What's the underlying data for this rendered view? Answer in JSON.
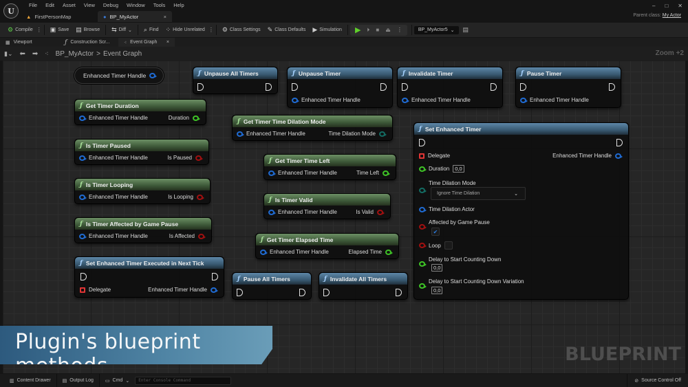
{
  "app": {
    "logo": "U",
    "menu": [
      "File",
      "Edit",
      "Asset",
      "View",
      "Debug",
      "Window",
      "Tools",
      "Help"
    ],
    "doc_tabs": [
      {
        "label": "FirstPersonMap",
        "icon": "level-icon"
      },
      {
        "label": "BP_MyActor",
        "icon": "blueprint-icon",
        "close": "×"
      }
    ],
    "window_controls": {
      "minimize": "–",
      "maximize": "□",
      "close": "✕"
    },
    "parent_class_label": "Parent class:",
    "parent_class_value": "My Actor"
  },
  "toolbar": {
    "compile": "Compile",
    "save": "Save",
    "browse": "Browse",
    "diff": "Diff",
    "find": "Find",
    "hide_unrelated": "Hide Unrelated",
    "class_settings": "Class Settings",
    "class_defaults": "Class Defaults",
    "simulation": "Simulation",
    "debug_object": "BP_MyActor5",
    "more": "⋮"
  },
  "panel_tabs": [
    {
      "label": "Viewport"
    },
    {
      "label": "Construction Scr..."
    },
    {
      "label": "Event Graph",
      "close": "×"
    }
  ],
  "breadcrumb": {
    "root": "BP_MyActor",
    "sep": ">",
    "current": "Event Graph"
  },
  "zoom_label": "Zoom +2",
  "graph": {
    "variable_node": {
      "label": "Enhanced Timer Handle"
    },
    "nodes": {
      "get_timer_duration": {
        "title": "Get Timer Duration",
        "in": "Enhanced Timer Handle",
        "out": "Duration"
      },
      "is_timer_paused": {
        "title": "Is Timer Paused",
        "in": "Enhanced Timer Handle",
        "out": "Is Paused"
      },
      "is_timer_looping": {
        "title": "Is Timer Looping",
        "in": "Enhanced Timer Handle",
        "out": "Is Looping"
      },
      "is_timer_affected": {
        "title": "Is Timer Affected by Game Pause",
        "in": "Enhanced Timer Handle",
        "out": "Is Affected"
      },
      "set_next_tick": {
        "title": "Set Enhanced Timer Executed in Next Tick",
        "in": "Delegate",
        "out": "Enhanced Timer Handle"
      },
      "unpause_all": {
        "title": "Unpause All Timers"
      },
      "unpause_timer": {
        "title": "Unpause Timer",
        "in": "Enhanced Timer Handle"
      },
      "invalidate_timer": {
        "title": "Invalidate Timer",
        "in": "Enhanced Timer Handle"
      },
      "pause_timer": {
        "title": "Pause Timer",
        "in": "Enhanced Timer Handle"
      },
      "get_dilation_mode": {
        "title": "Get Timer Time Dilation Mode",
        "in": "Enhanced Timer Handle",
        "out": "Time Dilation Mode"
      },
      "get_time_left": {
        "title": "Get Timer Time Left",
        "in": "Enhanced Timer Handle",
        "out": "Time Left"
      },
      "is_timer_valid": {
        "title": "Is Timer Valid",
        "in": "Enhanced Timer Handle",
        "out": "Is Valid"
      },
      "get_elapsed": {
        "title": "Get Timer Elapsed Time",
        "in": "Enhanced Timer Handle",
        "out": "Elapsed Time"
      },
      "pause_all": {
        "title": "Pause All Timers"
      },
      "invalidate_all": {
        "title": "Invalidate All Timers"
      },
      "set_enhanced_timer": {
        "title": "Set Enhanced Timer",
        "delegate": "Delegate",
        "out": "Enhanced Timer Handle",
        "duration_label": "Duration",
        "duration_value": "0,0",
        "dilation_mode_label": "Time Dilation Mode",
        "dilation_mode_value": "Ignore Time Dilation",
        "dilation_actor_label": "Time Dilation Actor",
        "affected_label": "Affected by Game Pause",
        "affected_checked": true,
        "loop_label": "Loop",
        "loop_checked": false,
        "delay_label": "Delay to Start Counting Down",
        "delay_value": "0,0",
        "delay_var_label": "Delay to Start Counting Down Variation",
        "delay_var_value": "0,0"
      }
    }
  },
  "banner": "Plugin's blueprint methods",
  "watermark": "BLUEPRINT",
  "statusbar": {
    "content_drawer": "Content Drawer",
    "output_log": "Output Log",
    "cmd": "Cmd",
    "console_placeholder": "Enter Console Command",
    "source_control": "Source Control Off"
  },
  "colors": {
    "pin_struct": "#1f6ad1",
    "pin_float": "#3ec226",
    "pin_bool": "#a01010",
    "pin_enum": "#136b62",
    "pin_delegate": "#e03535"
  }
}
